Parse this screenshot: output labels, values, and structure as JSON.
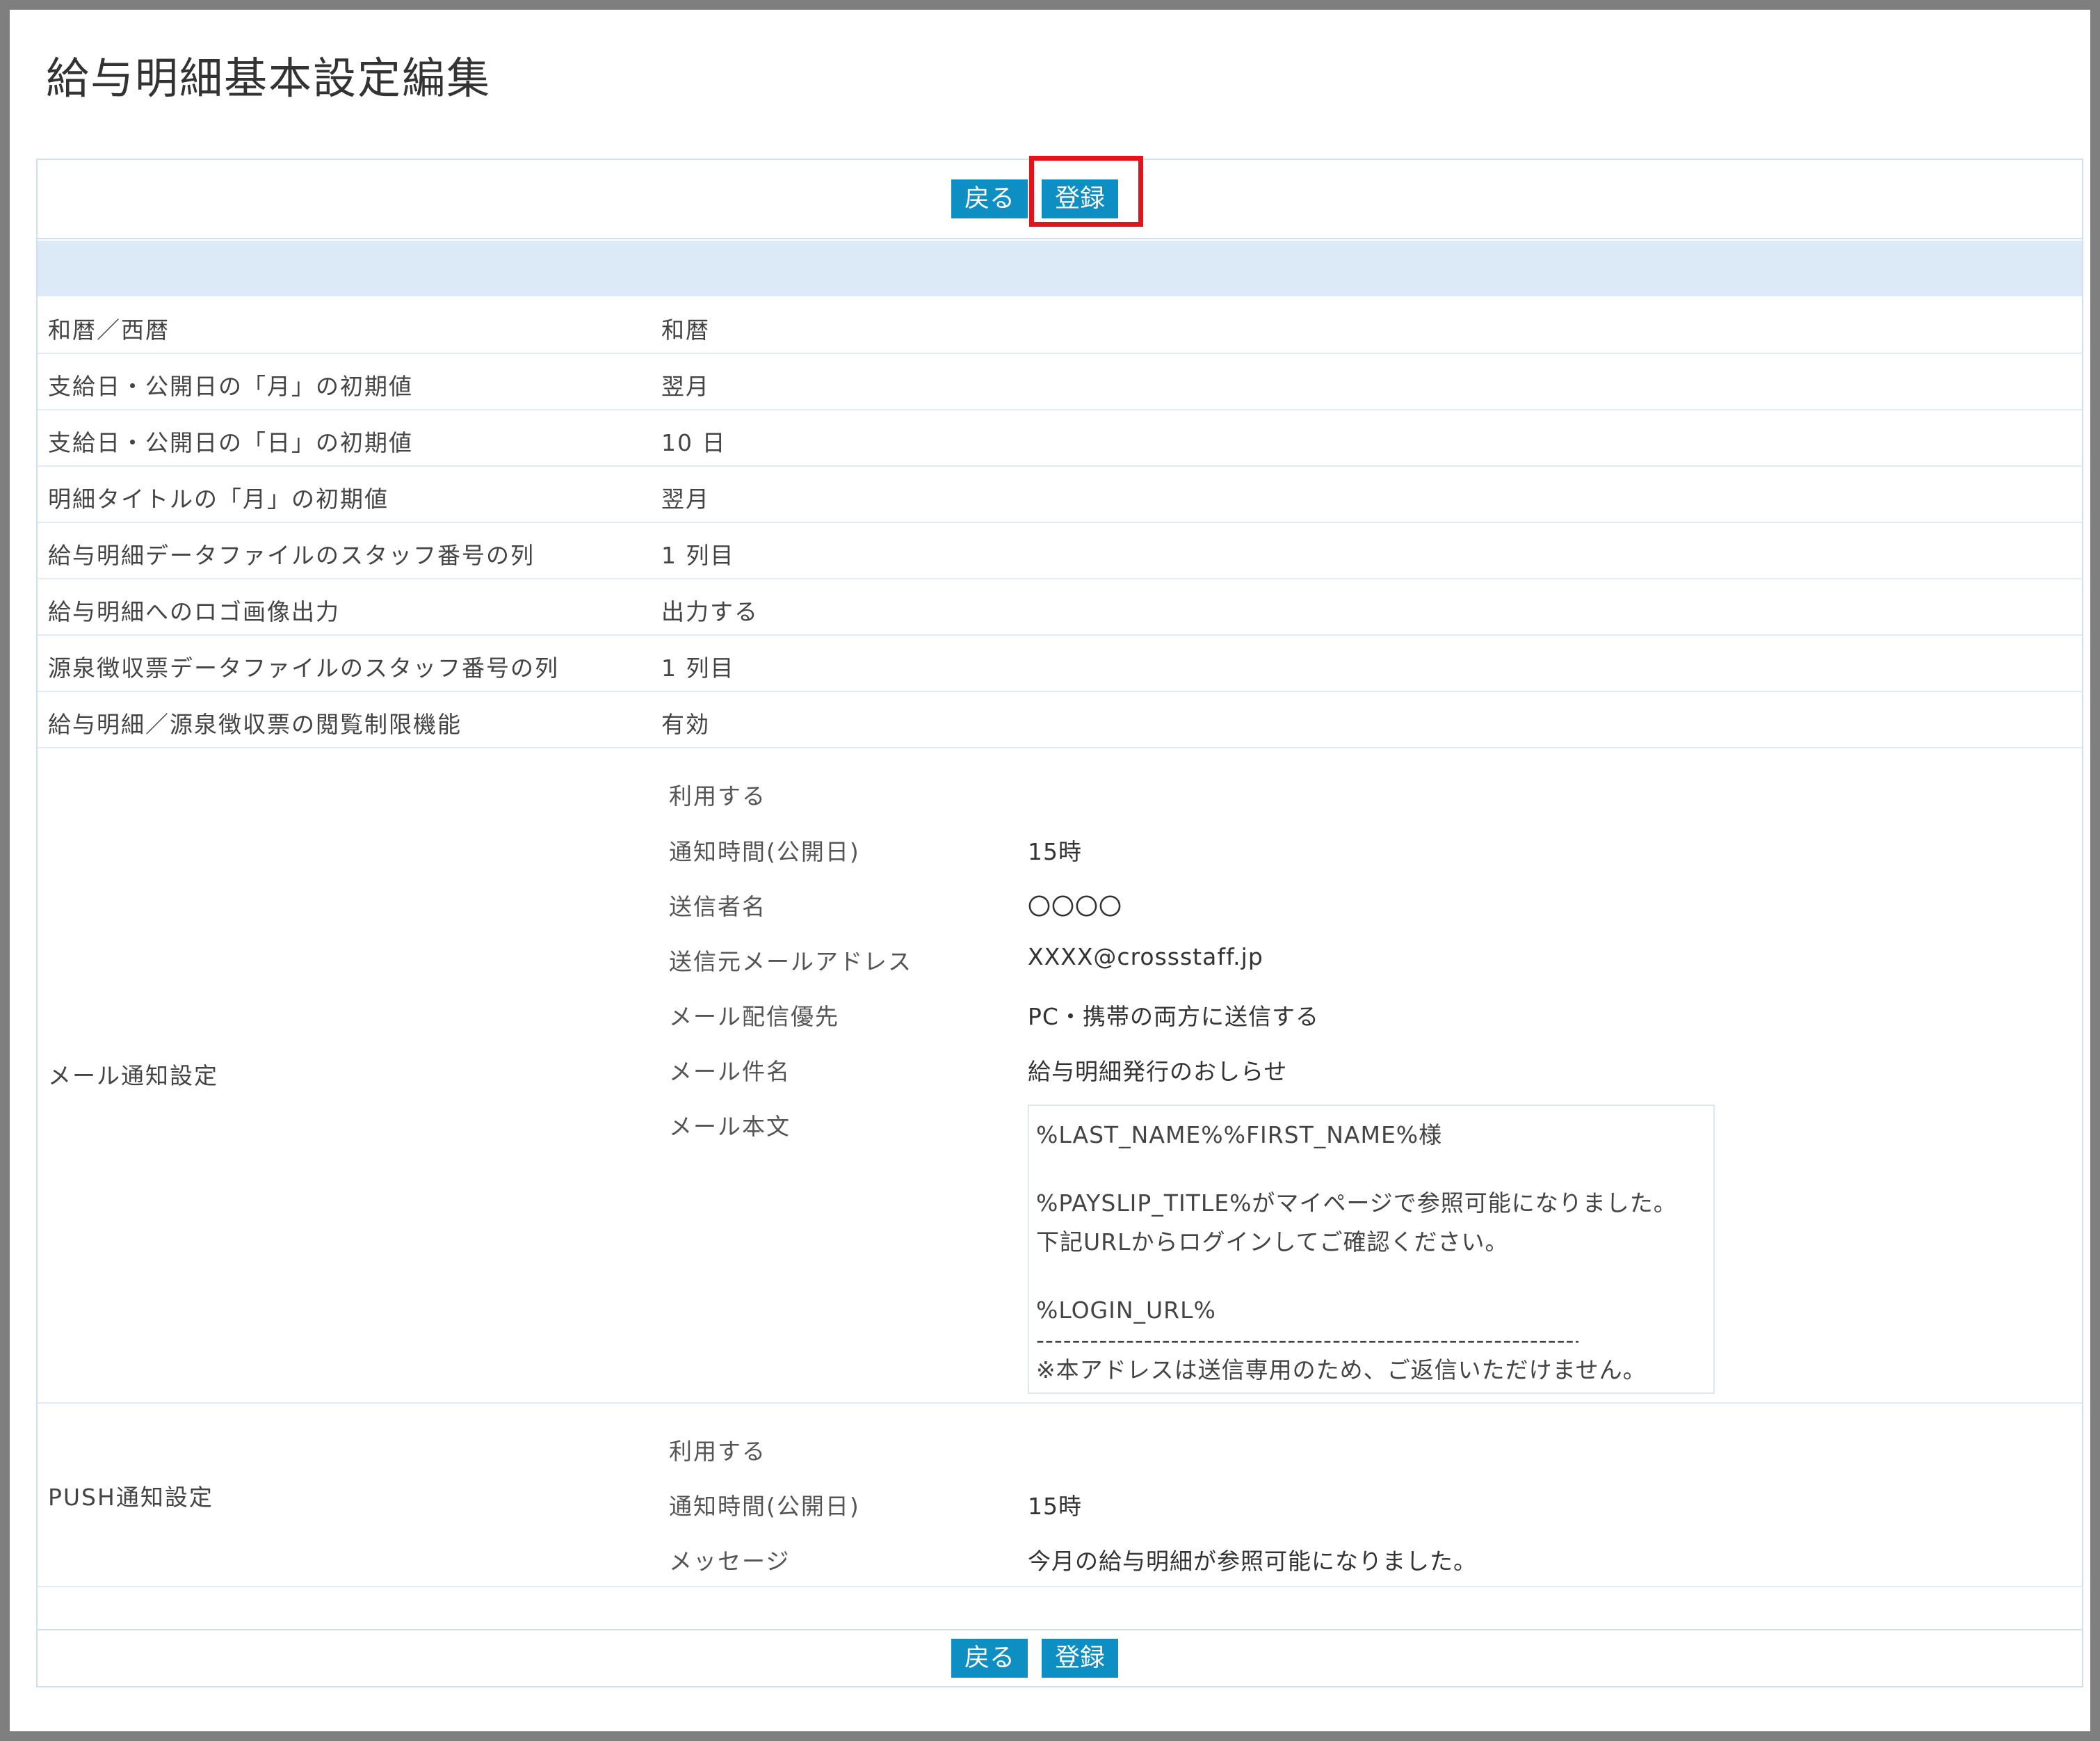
{
  "page": {
    "title": "給与明細基本設定編集"
  },
  "buttons": {
    "back": "戻る",
    "register": "登録"
  },
  "settings": [
    {
      "label": "和暦／西暦",
      "value": "和暦"
    },
    {
      "label": "支給日・公開日の「月」の初期値",
      "value": "翌月"
    },
    {
      "label": "支給日・公開日の「日」の初期値",
      "value": "10 日"
    },
    {
      "label": "明細タイトルの「月」の初期値",
      "value": "翌月"
    },
    {
      "label": "給与明細データファイルのスタッフ番号の列",
      "value": "1 列目"
    },
    {
      "label": "給与明細へのロゴ画像出力",
      "value": "出力する"
    },
    {
      "label": "源泉徴収票データファイルのスタッフ番号の列",
      "value": "1 列目"
    },
    {
      "label": "給与明細／源泉徴収票の閲覧制限機能",
      "value": "有効"
    }
  ],
  "mail": {
    "label": "メール通知設定",
    "status": "利用する",
    "items": [
      {
        "label": "通知時間(公開日)",
        "value": "15時"
      },
      {
        "label": "送信者名",
        "value": "〇〇〇〇"
      },
      {
        "label": "送信元メールアドレス",
        "value": "XXXX@crossstaff.jp"
      },
      {
        "label": "メール配信優先",
        "value": "PC・携帯の両方に送信する"
      },
      {
        "label": "メール件名",
        "value": "給与明細発行のおしらせ"
      }
    ],
    "body_label": "メール本文",
    "body_lines": [
      "%LAST_NAME%%FIRST_NAME%様",
      "%PAYSLIP_TITLE%がマイページで参照可能になりました。",
      "下記URLからログインしてご確認ください。",
      "%LOGIN_URL%",
      "----------------------------------------------------------------",
      "※本アドレスは送信専用のため、ご返信いただけません。"
    ]
  },
  "push": {
    "label": "PUSH通知設定",
    "status": "利用する",
    "items": [
      {
        "label": "通知時間(公開日)",
        "value": "15時"
      },
      {
        "label": "メッセージ",
        "value": "今月の給与明細が参照可能になりました。"
      }
    ]
  },
  "colors": {
    "button": "#0e8fc4",
    "highlight": "#e3131b",
    "band": "#dce9f7",
    "border": "#cfe0f2"
  }
}
